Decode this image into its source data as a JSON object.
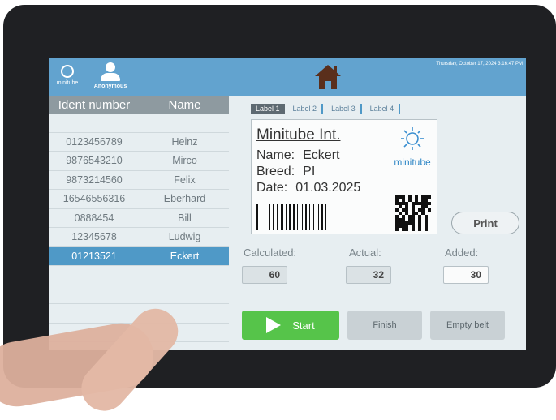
{
  "header": {
    "logo_text": "minitube",
    "user_label": "Anonymous",
    "datetime": "Thursday, October 17, 2024 3:16:47 PM",
    "home_icon": "home-icon"
  },
  "table": {
    "columns": [
      "Ident number",
      "Name"
    ],
    "rows": [
      {
        "id": "",
        "name": ""
      },
      {
        "id": "0123456789",
        "name": "Heinz"
      },
      {
        "id": "9876543210",
        "name": "Mirco"
      },
      {
        "id": "9873214560",
        "name": "Felix"
      },
      {
        "id": "16546556316",
        "name": "Eberhard"
      },
      {
        "id": "0888454",
        "name": "Bill"
      },
      {
        "id": "12345678",
        "name": "Ludwig"
      },
      {
        "id": "01213521",
        "name": "Eckert"
      },
      {
        "id": "",
        "name": ""
      },
      {
        "id": "",
        "name": ""
      },
      {
        "id": "",
        "name": ""
      },
      {
        "id": "",
        "name": ""
      },
      {
        "id": "",
        "name": ""
      }
    ],
    "selected_index": 7
  },
  "tabs": [
    "Label 1",
    "Label 2",
    "Label 3",
    "Label 4"
  ],
  "active_tab": 0,
  "label": {
    "company": "Minitube Int.",
    "name_label": "Name:",
    "name_value": "Eckert",
    "breed_label": "Breed:",
    "breed_value": "PI",
    "date_label": "Date:",
    "date_value": "01.03.2025",
    "logo_text": "minitube"
  },
  "buttons": {
    "print": "Print",
    "start": "Start",
    "finish": "Finish",
    "empty_belt": "Empty belt"
  },
  "fields": {
    "calculated_label": "Calculated:",
    "calculated_value": "60",
    "actual_label": "Actual:",
    "actual_value": "32",
    "added_label": "Added:",
    "added_value": "30"
  },
  "colors": {
    "header": "#62a3cf",
    "selected_row": "#4f99c7",
    "start_button": "#56c44a"
  }
}
